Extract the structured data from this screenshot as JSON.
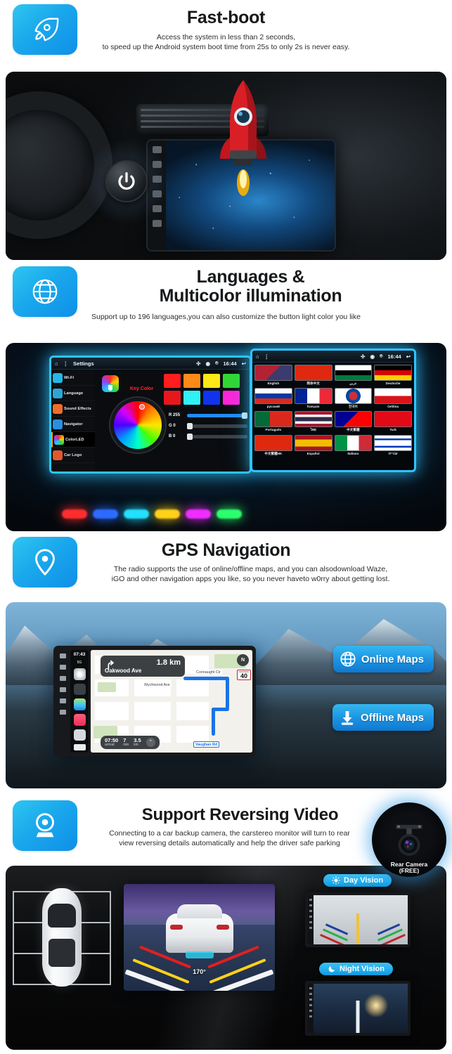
{
  "meta": {
    "accent": "#1b92e2",
    "badge_start": "#2ec6f0",
    "badge_end": "#0f8fe8"
  },
  "sections": [
    {
      "icon": "rocket-icon",
      "title": "Fast-boot",
      "sub_line1": "Access the system in less than 2 seconds,",
      "sub_line2": "to speed up the Android system boot time from 25s to only 2s is never easy."
    },
    {
      "icon": "globe-icon",
      "title_line1": "Languages &",
      "title_line2": "Multicolor illumination",
      "sub_line1": "Support up to 196 languages,you can also customize the button light color you like"
    },
    {
      "icon": "location-pin-icon",
      "title": "GPS Navigation",
      "sub_line1": "The radio supports the use of online/offline maps, and you can alsodownload Waze,",
      "sub_line2": "iGO and other navigation apps you like, so you never haveto w0rry about getting lost."
    },
    {
      "icon": "camera-icon",
      "title": "Support Reversing Video",
      "sub_line1": "Connecting to a car backup camera, the carstereo monitor will turn to rear",
      "sub_line2": "view reversing details automatically and help the driver safe parking"
    }
  ],
  "led_screen": {
    "statusbar": {
      "title": "Settings",
      "time": "16:44"
    },
    "menu": [
      {
        "label": "Wi-Fi",
        "color": "#25b7e8"
      },
      {
        "label": "Language",
        "color": "#2aa7d8"
      },
      {
        "label": "Sound Effects",
        "color": "#ef6c2a"
      },
      {
        "label": "Navigator",
        "color": "#2a8fe0"
      },
      {
        "label": "ColorLED",
        "color": "#ffffff"
      },
      {
        "label": "Car Logo",
        "color": "#e2582b"
      }
    ],
    "key_color_label": "Key Color",
    "swatch_row1": [
      "#ff1d1d",
      "#ff8a1a",
      "#ffe818",
      "#32d82f"
    ],
    "swatch_row2": [
      "#e8171d",
      "#2ff0f5",
      "#1133ee",
      "#ff24d8",
      "#ffffff"
    ],
    "sliders": [
      {
        "label": "R",
        "value": "255",
        "pct": 100
      },
      {
        "label": "G",
        "value": "0",
        "pct": 0
      },
      {
        "label": "B",
        "value": "0",
        "pct": 0
      }
    ]
  },
  "flags_screen": {
    "statusbar_time": "16:44",
    "items": [
      {
        "name": "English",
        "c1": "#3c3b6e",
        "c2": "#b22234"
      },
      {
        "name": "简体中文",
        "c1": "#de2910",
        "c2": "#de2910"
      },
      {
        "name": "عربي",
        "c1": "#ffffff",
        "c2": "#007a3d"
      },
      {
        "name": "Deutsche",
        "c1": "#000000",
        "c2": "#dd0000"
      },
      {
        "name": "русский",
        "c1": "#ffffff",
        "c2": "#d52b1e"
      },
      {
        "name": "français",
        "c1": "#002395",
        "c2": "#ed2939"
      },
      {
        "name": "한국어",
        "c1": "#ffffff",
        "c2": "#cd2e3a"
      },
      {
        "name": "čeština",
        "c1": "#ffffff",
        "c2": "#d7141a"
      },
      {
        "name": "Português",
        "c1": "#046a38",
        "c2": "#da291c"
      },
      {
        "name": "ไทย",
        "c1": "#a51931",
        "c2": "#2d2a4a"
      },
      {
        "name": "中文繁體",
        "c1": "#fe0000",
        "c2": "#000095"
      },
      {
        "name": "Turk",
        "c1": "#e30a17",
        "c2": "#e30a17"
      },
      {
        "name": "中文繁體HK",
        "c1": "#de2910",
        "c2": "#de2910"
      },
      {
        "name": "Español",
        "c1": "#aa151b",
        "c2": "#f1bf00"
      },
      {
        "name": "Italiano",
        "c1": "#009246",
        "c2": "#ce2b37"
      },
      {
        "name": "עברית",
        "c1": "#ffffff",
        "c2": "#0038b8"
      }
    ]
  },
  "gps_screen": {
    "carplay_time": "07:43",
    "carplay_signal": "5G",
    "direction": {
      "distance": "1.8 km",
      "street": "Oakwood Ave"
    },
    "compass": "N",
    "speed_limit": {
      "caption": "MAXIMUM",
      "value": "40"
    },
    "map_labels": [
      "Connaught Cir",
      "Wychwood Ave",
      "Vaughan Rd"
    ],
    "eta": [
      {
        "value": "07:50",
        "unit": "arrival"
      },
      {
        "value": "7",
        "unit": "min"
      },
      {
        "value": "3.5",
        "unit": "km"
      }
    ],
    "buttons": [
      {
        "label": "Online Maps",
        "icon": "globe-icon"
      },
      {
        "label": "Offline Maps",
        "icon": "download-icon"
      }
    ]
  },
  "reversing_screen": {
    "angle_label": "170°",
    "camera_badge_line1": "Rear Camera",
    "camera_badge_line2": "(FREE)",
    "pills": [
      {
        "label": "Day Vision",
        "icon": "sun-icon"
      },
      {
        "label": "Night Vision",
        "icon": "moon-icon"
      }
    ]
  }
}
